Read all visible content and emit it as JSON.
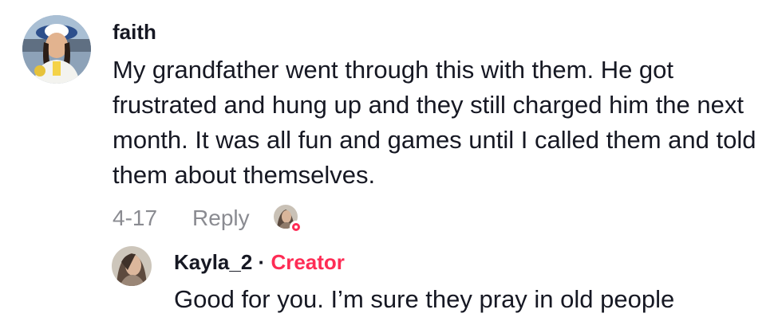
{
  "comment": {
    "author": "faith",
    "text": "My grandfather went through this with them. He got frustrated and hung up and they still charged him the next month. It was all fun and games until I called them and told them about themselves.",
    "date": "4-17",
    "reply_label": "Reply",
    "liked_by_creator": true
  },
  "reply": {
    "author": "Kayla_2",
    "separator": "·",
    "badge": "Creator",
    "text": "Good for you. I’m sure they pray in old people"
  },
  "colors": {
    "text": "#161823",
    "muted": "#8a8b91",
    "creator": "#fe2c55"
  }
}
